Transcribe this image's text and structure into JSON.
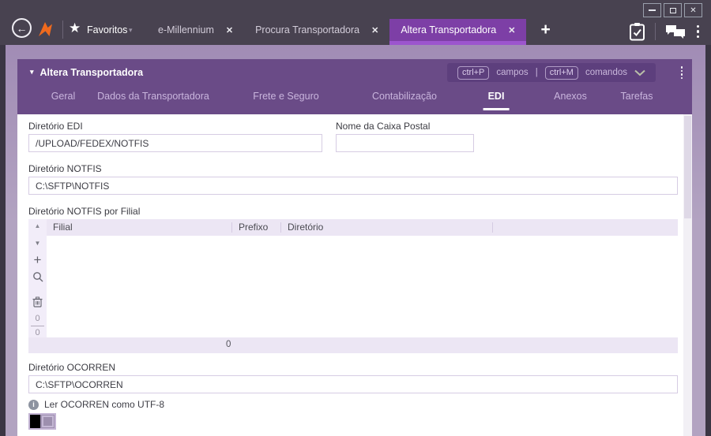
{
  "colors": {
    "titlebar_bg": "#484250",
    "active_tab_bg": "#7d3fa6",
    "active_tab_underline": "#9c55ce",
    "panel_header_bg": "#6a4b87",
    "shortcut_pill_bg": "#5d3f7d",
    "content_bg": "#aa99bd",
    "logo_orange": "#f06a1d",
    "grid_header_bg": "#ece6f4"
  },
  "icons": {
    "back": "←",
    "close": "✕",
    "star": "★",
    "caret_down": "▾",
    "plus": "+",
    "triangle_down": "▾",
    "grid_up": "▲",
    "grid_down": "▼",
    "grid_add": "+",
    "info": "i"
  },
  "titlebar": {
    "favorites_label": "Favoritos",
    "tabs": [
      {
        "label": "e-Millennium"
      },
      {
        "label": "Procura Transportadora"
      },
      {
        "label": "Altera Transportadora"
      }
    ]
  },
  "form": {
    "title": "Altera Transportadora",
    "shortcuts": {
      "key1": "ctrl+P",
      "label1": "campos",
      "separator": "|",
      "key2": "ctrl+M",
      "label2": "comandos"
    },
    "tabs": [
      "Geral",
      "Dados da Transportadora",
      "Frete e Seguro",
      "Contabilização",
      "EDI",
      "Anexos",
      "Tarefas"
    ],
    "active_tab": "EDI",
    "fields": {
      "diretorio_edi": {
        "label": "Diretório EDI",
        "value": "/UPLOAD/FEDEX/NOTFIS"
      },
      "nome_caixa_postal": {
        "label": "Nome da Caixa Postal",
        "value": ""
      },
      "diretorio_notfis": {
        "label": "Diretório NOTFIS",
        "value": "C:\\SFTP\\NOTFIS"
      },
      "diretorio_ocorren": {
        "label": "Diretório OCORREN",
        "value": "C:\\SFTP\\OCORREN"
      }
    },
    "grid": {
      "label": "Diretório NOTFIS por Filial",
      "columns": [
        "Filial",
        "Prefixo",
        "Diretório"
      ],
      "rows": [],
      "selected_count": "0",
      "total_count": "0",
      "footer_count": "0"
    },
    "utf8_label": "Ler OCORREN como UTF-8"
  }
}
